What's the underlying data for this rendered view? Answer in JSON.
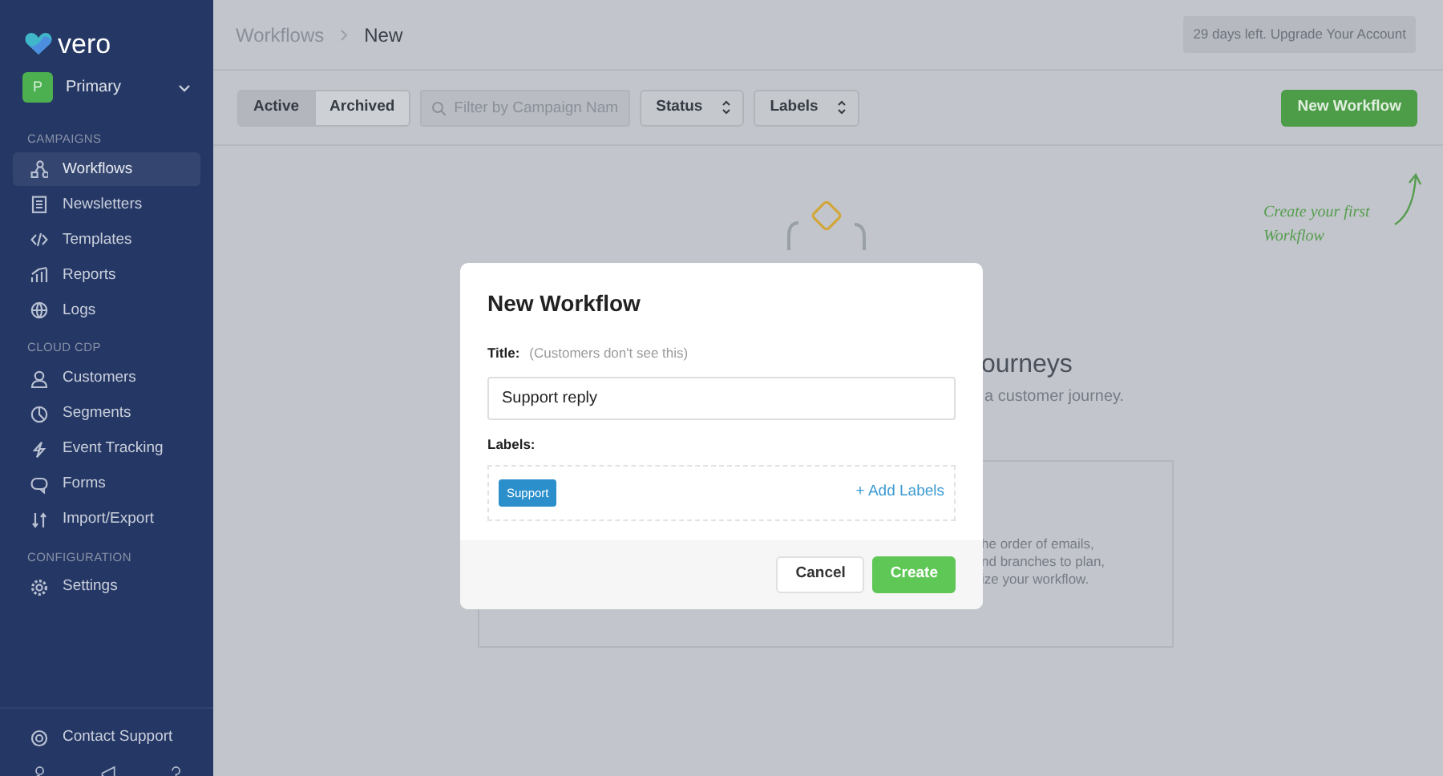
{
  "sidebar": {
    "logo": "vero",
    "account": {
      "initial": "P",
      "name": "Primary"
    },
    "sections": [
      {
        "heading": "CAMPAIGNS",
        "items": [
          {
            "label": "Workflows",
            "selected": true
          },
          {
            "label": "Newsletters",
            "selected": false
          },
          {
            "label": "Templates",
            "selected": false
          },
          {
            "label": "Reports",
            "selected": false
          },
          {
            "label": "Logs",
            "selected": false
          }
        ]
      },
      {
        "heading": "CLOUD CDP",
        "items": [
          {
            "label": "Customers",
            "selected": false
          },
          {
            "label": "Segments",
            "selected": false
          },
          {
            "label": "Event Tracking",
            "selected": false
          },
          {
            "label": "Forms",
            "selected": false
          },
          {
            "label": "Import/Export",
            "selected": false
          }
        ]
      },
      {
        "heading": "CONFIGURATION",
        "items": [
          {
            "label": "Settings",
            "selected": false
          }
        ]
      }
    ],
    "footer_item": "Contact Support"
  },
  "header": {
    "breadcrumbs": [
      "Workflows",
      "New"
    ],
    "trial_notice": "29 days left. Upgrade Your Account"
  },
  "toolbar": {
    "filter_tabs": [
      {
        "label": "Active",
        "selected": true
      },
      {
        "label": "Archived",
        "selected": false
      }
    ],
    "search": {
      "placeholder": "Filter by Campaign Nam"
    },
    "dropdowns": [
      "Status",
      "Labels"
    ],
    "primary_button": "New Workflow"
  },
  "empty_state": {
    "heading": "ourneys",
    "subtitle": "a customer journey.",
    "card_lines": [
      "he order of emails,",
      "nd branches to plan,",
      "ize your workflow."
    ],
    "hint": "Create your first Workflow"
  },
  "modal": {
    "title": "New Workflow",
    "title_label": "Title:",
    "title_hint": "(Customers don't see this)",
    "title_value": "Support reply",
    "labels_label": "Labels:",
    "labels": [
      "Support"
    ],
    "add_labels": "+ Add Labels",
    "cancel": "Cancel",
    "create": "Create"
  }
}
